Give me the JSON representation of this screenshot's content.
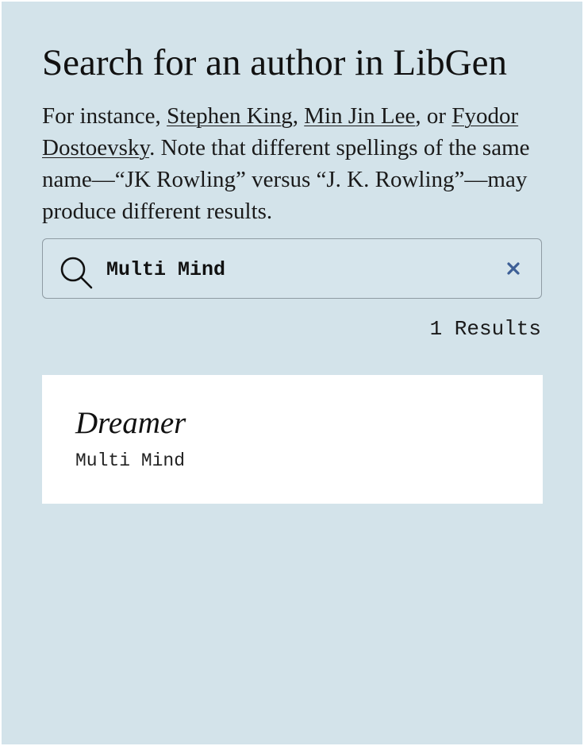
{
  "header": {
    "title": "Search for an author in LibGen"
  },
  "intro": {
    "prefix": "For instance, ",
    "examples": [
      "Stephen King",
      "Min Jin Lee",
      "Fyodor Dostoevsky"
    ],
    "sep1": ", ",
    "sep2": ", or ",
    "suffix": ". Note that different spellings of the same name—“JK Rowling” versus “J. K. Rowling”—may produce different results."
  },
  "search": {
    "value": "Multi Mind",
    "icon": "search-icon",
    "clear_icon": "close-icon"
  },
  "results": {
    "count_label": "1 Results",
    "items": [
      {
        "title": "Dreamer",
        "author": "Multi Mind"
      }
    ]
  },
  "colors": {
    "background": "#d3e3ea",
    "card": "#ffffff",
    "clear_icon": "#3d5f96"
  }
}
